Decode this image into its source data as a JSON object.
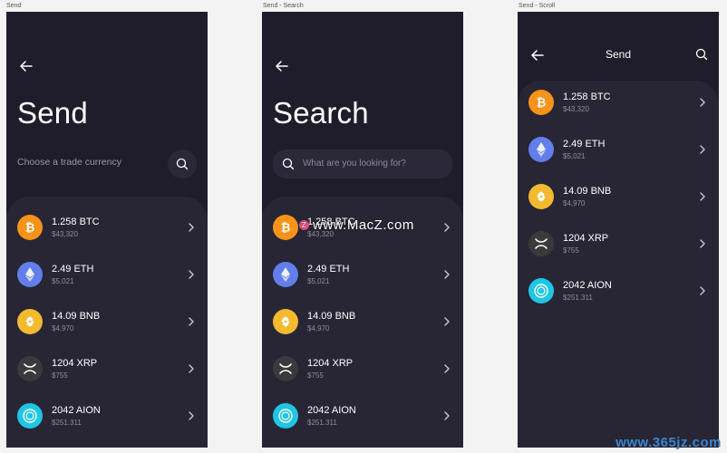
{
  "frames": {
    "send": {
      "label": "Send",
      "title": "Send",
      "trade_label": "Choose a trade currency"
    },
    "search": {
      "label": "Send - Search",
      "title": "Search",
      "placeholder": "What are you looking for?"
    },
    "scroll": {
      "label": "Send - Scroll",
      "header_title": "Send"
    }
  },
  "coins": [
    {
      "amount": "1.258 BTC",
      "value": "$43,320",
      "color": "#f7931a",
      "icon": "bitcoin-icon"
    },
    {
      "amount": "2.49 ETH",
      "value": "$5,021",
      "color": "#627eea",
      "icon": "ethereum-icon"
    },
    {
      "amount": "14.09 BNB",
      "value": "$4,970",
      "color": "#f3ba2f",
      "icon": "binance-icon"
    },
    {
      "amount": "1204 XRP",
      "value": "$755",
      "color": "#3a3a3d",
      "icon": "xrp-icon"
    },
    {
      "amount": "2042 AION",
      "value": "$251.311",
      "color": "#1ec6e6",
      "icon": "aion-icon"
    }
  ],
  "watermark": {
    "text": "www.MacZ.com",
    "badge": "Z"
  },
  "footer_watermark": "www.365jz.com"
}
